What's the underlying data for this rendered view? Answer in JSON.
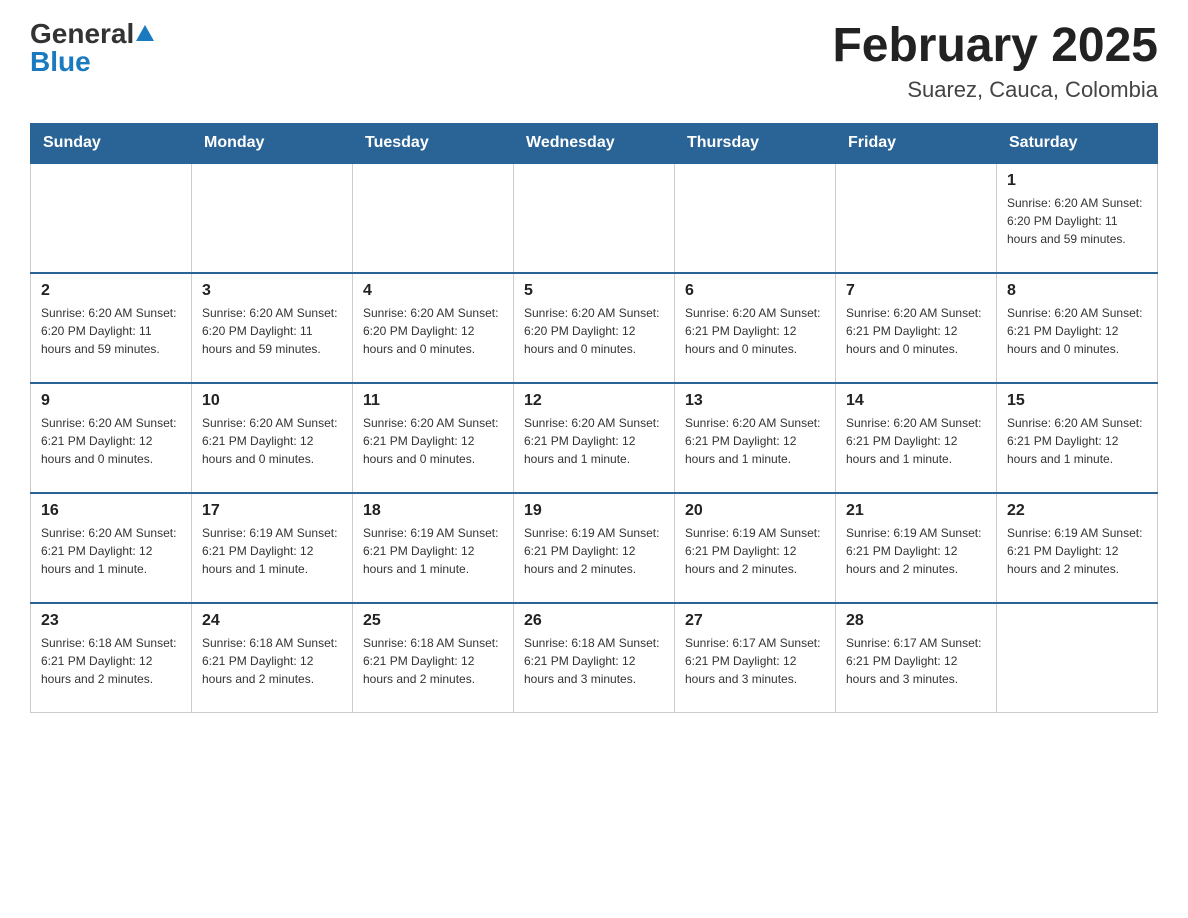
{
  "header": {
    "logo_general": "General",
    "logo_blue": "Blue",
    "title": "February 2025",
    "location": "Suarez, Cauca, Colombia"
  },
  "days_of_week": [
    "Sunday",
    "Monday",
    "Tuesday",
    "Wednesday",
    "Thursday",
    "Friday",
    "Saturday"
  ],
  "weeks": [
    [
      {
        "day": "",
        "info": ""
      },
      {
        "day": "",
        "info": ""
      },
      {
        "day": "",
        "info": ""
      },
      {
        "day": "",
        "info": ""
      },
      {
        "day": "",
        "info": ""
      },
      {
        "day": "",
        "info": ""
      },
      {
        "day": "1",
        "info": "Sunrise: 6:20 AM\nSunset: 6:20 PM\nDaylight: 11 hours and 59 minutes."
      }
    ],
    [
      {
        "day": "2",
        "info": "Sunrise: 6:20 AM\nSunset: 6:20 PM\nDaylight: 11 hours and 59 minutes."
      },
      {
        "day": "3",
        "info": "Sunrise: 6:20 AM\nSunset: 6:20 PM\nDaylight: 11 hours and 59 minutes."
      },
      {
        "day": "4",
        "info": "Sunrise: 6:20 AM\nSunset: 6:20 PM\nDaylight: 12 hours and 0 minutes."
      },
      {
        "day": "5",
        "info": "Sunrise: 6:20 AM\nSunset: 6:20 PM\nDaylight: 12 hours and 0 minutes."
      },
      {
        "day": "6",
        "info": "Sunrise: 6:20 AM\nSunset: 6:21 PM\nDaylight: 12 hours and 0 minutes."
      },
      {
        "day": "7",
        "info": "Sunrise: 6:20 AM\nSunset: 6:21 PM\nDaylight: 12 hours and 0 minutes."
      },
      {
        "day": "8",
        "info": "Sunrise: 6:20 AM\nSunset: 6:21 PM\nDaylight: 12 hours and 0 minutes."
      }
    ],
    [
      {
        "day": "9",
        "info": "Sunrise: 6:20 AM\nSunset: 6:21 PM\nDaylight: 12 hours and 0 minutes."
      },
      {
        "day": "10",
        "info": "Sunrise: 6:20 AM\nSunset: 6:21 PM\nDaylight: 12 hours and 0 minutes."
      },
      {
        "day": "11",
        "info": "Sunrise: 6:20 AM\nSunset: 6:21 PM\nDaylight: 12 hours and 0 minutes."
      },
      {
        "day": "12",
        "info": "Sunrise: 6:20 AM\nSunset: 6:21 PM\nDaylight: 12 hours and 1 minute."
      },
      {
        "day": "13",
        "info": "Sunrise: 6:20 AM\nSunset: 6:21 PM\nDaylight: 12 hours and 1 minute."
      },
      {
        "day": "14",
        "info": "Sunrise: 6:20 AM\nSunset: 6:21 PM\nDaylight: 12 hours and 1 minute."
      },
      {
        "day": "15",
        "info": "Sunrise: 6:20 AM\nSunset: 6:21 PM\nDaylight: 12 hours and 1 minute."
      }
    ],
    [
      {
        "day": "16",
        "info": "Sunrise: 6:20 AM\nSunset: 6:21 PM\nDaylight: 12 hours and 1 minute."
      },
      {
        "day": "17",
        "info": "Sunrise: 6:19 AM\nSunset: 6:21 PM\nDaylight: 12 hours and 1 minute."
      },
      {
        "day": "18",
        "info": "Sunrise: 6:19 AM\nSunset: 6:21 PM\nDaylight: 12 hours and 1 minute."
      },
      {
        "day": "19",
        "info": "Sunrise: 6:19 AM\nSunset: 6:21 PM\nDaylight: 12 hours and 2 minutes."
      },
      {
        "day": "20",
        "info": "Sunrise: 6:19 AM\nSunset: 6:21 PM\nDaylight: 12 hours and 2 minutes."
      },
      {
        "day": "21",
        "info": "Sunrise: 6:19 AM\nSunset: 6:21 PM\nDaylight: 12 hours and 2 minutes."
      },
      {
        "day": "22",
        "info": "Sunrise: 6:19 AM\nSunset: 6:21 PM\nDaylight: 12 hours and 2 minutes."
      }
    ],
    [
      {
        "day": "23",
        "info": "Sunrise: 6:18 AM\nSunset: 6:21 PM\nDaylight: 12 hours and 2 minutes."
      },
      {
        "day": "24",
        "info": "Sunrise: 6:18 AM\nSunset: 6:21 PM\nDaylight: 12 hours and 2 minutes."
      },
      {
        "day": "25",
        "info": "Sunrise: 6:18 AM\nSunset: 6:21 PM\nDaylight: 12 hours and 2 minutes."
      },
      {
        "day": "26",
        "info": "Sunrise: 6:18 AM\nSunset: 6:21 PM\nDaylight: 12 hours and 3 minutes."
      },
      {
        "day": "27",
        "info": "Sunrise: 6:17 AM\nSunset: 6:21 PM\nDaylight: 12 hours and 3 minutes."
      },
      {
        "day": "28",
        "info": "Sunrise: 6:17 AM\nSunset: 6:21 PM\nDaylight: 12 hours and 3 minutes."
      },
      {
        "day": "",
        "info": ""
      }
    ]
  ]
}
